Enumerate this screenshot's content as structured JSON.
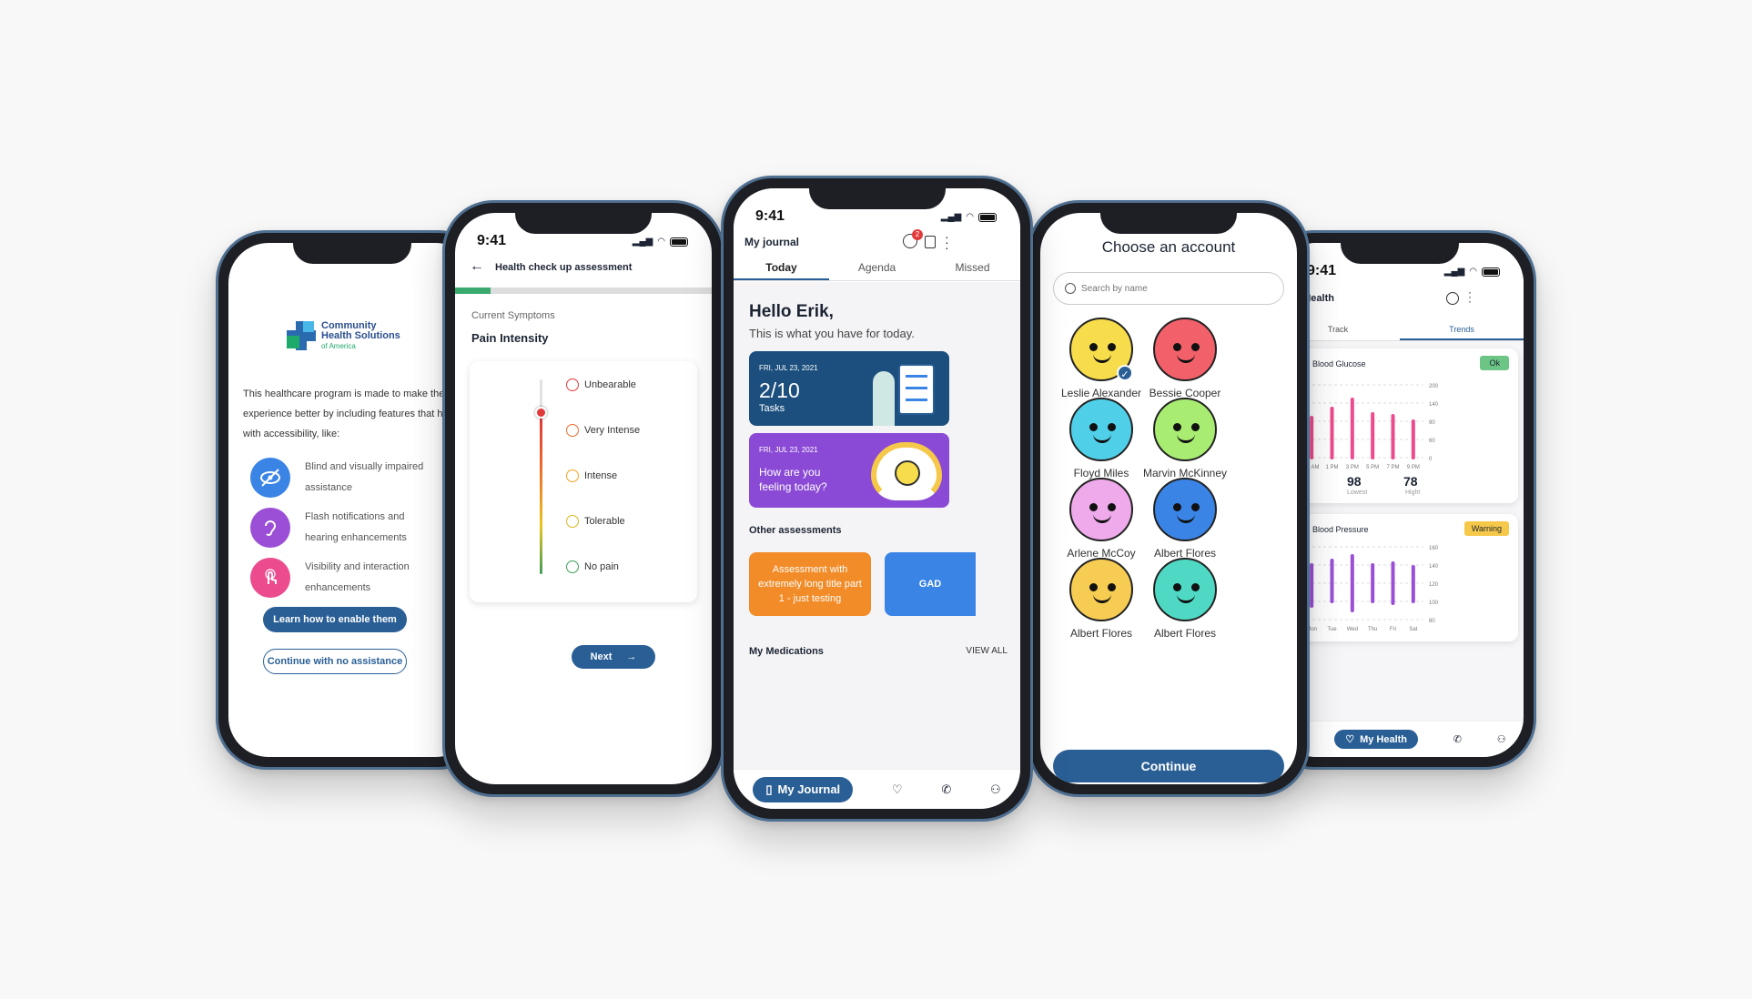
{
  "p1": {
    "logo": {
      "line1": "Community",
      "line2": "Health Solutions",
      "line3": "of America"
    },
    "intro": "This healthcare program is made to make the user experience better by including features that help with accessibility, like:",
    "features": [
      {
        "label": "Blind and visually impaired assistance",
        "icon": "eye-slash-icon",
        "color": "#3a84e6"
      },
      {
        "label": "Flash notifications and hearing enhancements",
        "icon": "ear-icon",
        "color": "#9b4fd6"
      },
      {
        "label": "Visibility and interaction enhancements",
        "icon": "touch-icon",
        "color": "#ec4b8e"
      }
    ],
    "primary_btn": "Learn how to enable them",
    "secondary_btn": "Continue with no assistance"
  },
  "p2": {
    "time": "9:41",
    "title": "Health check up assessment",
    "progress": 0.14,
    "section": "Current Symptoms",
    "question": "Pain Intensity",
    "levels": [
      {
        "label": "Unbearable",
        "color": "#e03a3a"
      },
      {
        "label": "Very Intense",
        "color": "#ee6a2c"
      },
      {
        "label": "Intense",
        "color": "#f0a21f"
      },
      {
        "label": "Tolerable",
        "color": "#d9b41e"
      },
      {
        "label": "No pain",
        "color": "#3f9d57"
      }
    ],
    "selected_level": "Very Intense",
    "next_btn": "Next"
  },
  "p3": {
    "time": "9:41",
    "header": "My journal",
    "badge": "2",
    "tabs": [
      "Today",
      "Agenda",
      "Missed"
    ],
    "greeting": "Hello Erik,",
    "subtitle": "This is what you have for today.",
    "tasks_card": {
      "date": "FRI, JUL 23, 2021",
      "value": "2/10",
      "label": "Tasks",
      "color": "#1c4f7e"
    },
    "mood_card": {
      "date": "FRI, JUL 23, 2021",
      "text": "How are you feeling today?",
      "color": "#8b4ad6"
    },
    "other_heading": "Other assessments",
    "assessments": [
      {
        "label": "Assessment with extremely long title part 1 - just testing",
        "color": "#f28c28"
      },
      {
        "label": "GAD",
        "color": "#3a84e6"
      }
    ],
    "meds_heading": "My Medications",
    "view_all": "VIEW ALL",
    "nav_active": "My Journal"
  },
  "p4": {
    "title": "Choose an account",
    "search_placeholder": "Search by name",
    "accounts": [
      {
        "name": "Leslie Alexander",
        "color": "#f7dc4b",
        "selected": true
      },
      {
        "name": "Bessie Cooper",
        "color": "#f2606a",
        "selected": false
      },
      {
        "name": "Floyd Miles",
        "color": "#4fd0e8",
        "selected": false
      },
      {
        "name": "Marvin McKinney",
        "color": "#a8ec72",
        "selected": false
      },
      {
        "name": "Arlene McCoy",
        "color": "#eeaaea",
        "selected": false
      },
      {
        "name": "Albert Flores",
        "color": "#3a84e6",
        "selected": false
      },
      {
        "name": "Albert Flores",
        "color": "#f7cc52",
        "selected": false
      },
      {
        "name": "Albert Flores",
        "color": "#4fd9c4",
        "selected": false
      }
    ],
    "continue_btn": "Continue"
  },
  "p5": {
    "time": "9:41",
    "header": "My Health",
    "tabs": [
      "Track",
      "Trends"
    ],
    "glucose": {
      "title": "Blood Glucose",
      "status": "Ok",
      "status_color": "#6cc584",
      "accent": "#ec4b8e",
      "yticks": [
        "200",
        "140",
        "90",
        "60",
        "0"
      ],
      "xticks": [
        "11 AM",
        "1 PM",
        "3 PM",
        "5 PM",
        "7 PM",
        "9 PM"
      ],
      "bars": [
        110,
        135,
        160,
        120,
        115,
        100
      ],
      "lowest": "98",
      "lowest_label": "Lowest",
      "highest": "78",
      "highest_label": "Hight"
    },
    "pressure": {
      "title": "Blood Pressure",
      "status": "Warning",
      "status_color": "#f5c84a",
      "accent": "#9b4fd6",
      "yticks": [
        "160",
        "140",
        "120",
        "100",
        "80"
      ],
      "xticks": [
        "Mon",
        "Tue",
        "Wed",
        "Thu",
        "Fri",
        "Sat"
      ],
      "bars": [
        [
          95,
          140
        ],
        [
          100,
          145
        ],
        [
          90,
          150
        ],
        [
          100,
          140
        ],
        [
          98,
          142
        ],
        [
          100,
          138
        ]
      ]
    },
    "nav_active": "My Health"
  }
}
